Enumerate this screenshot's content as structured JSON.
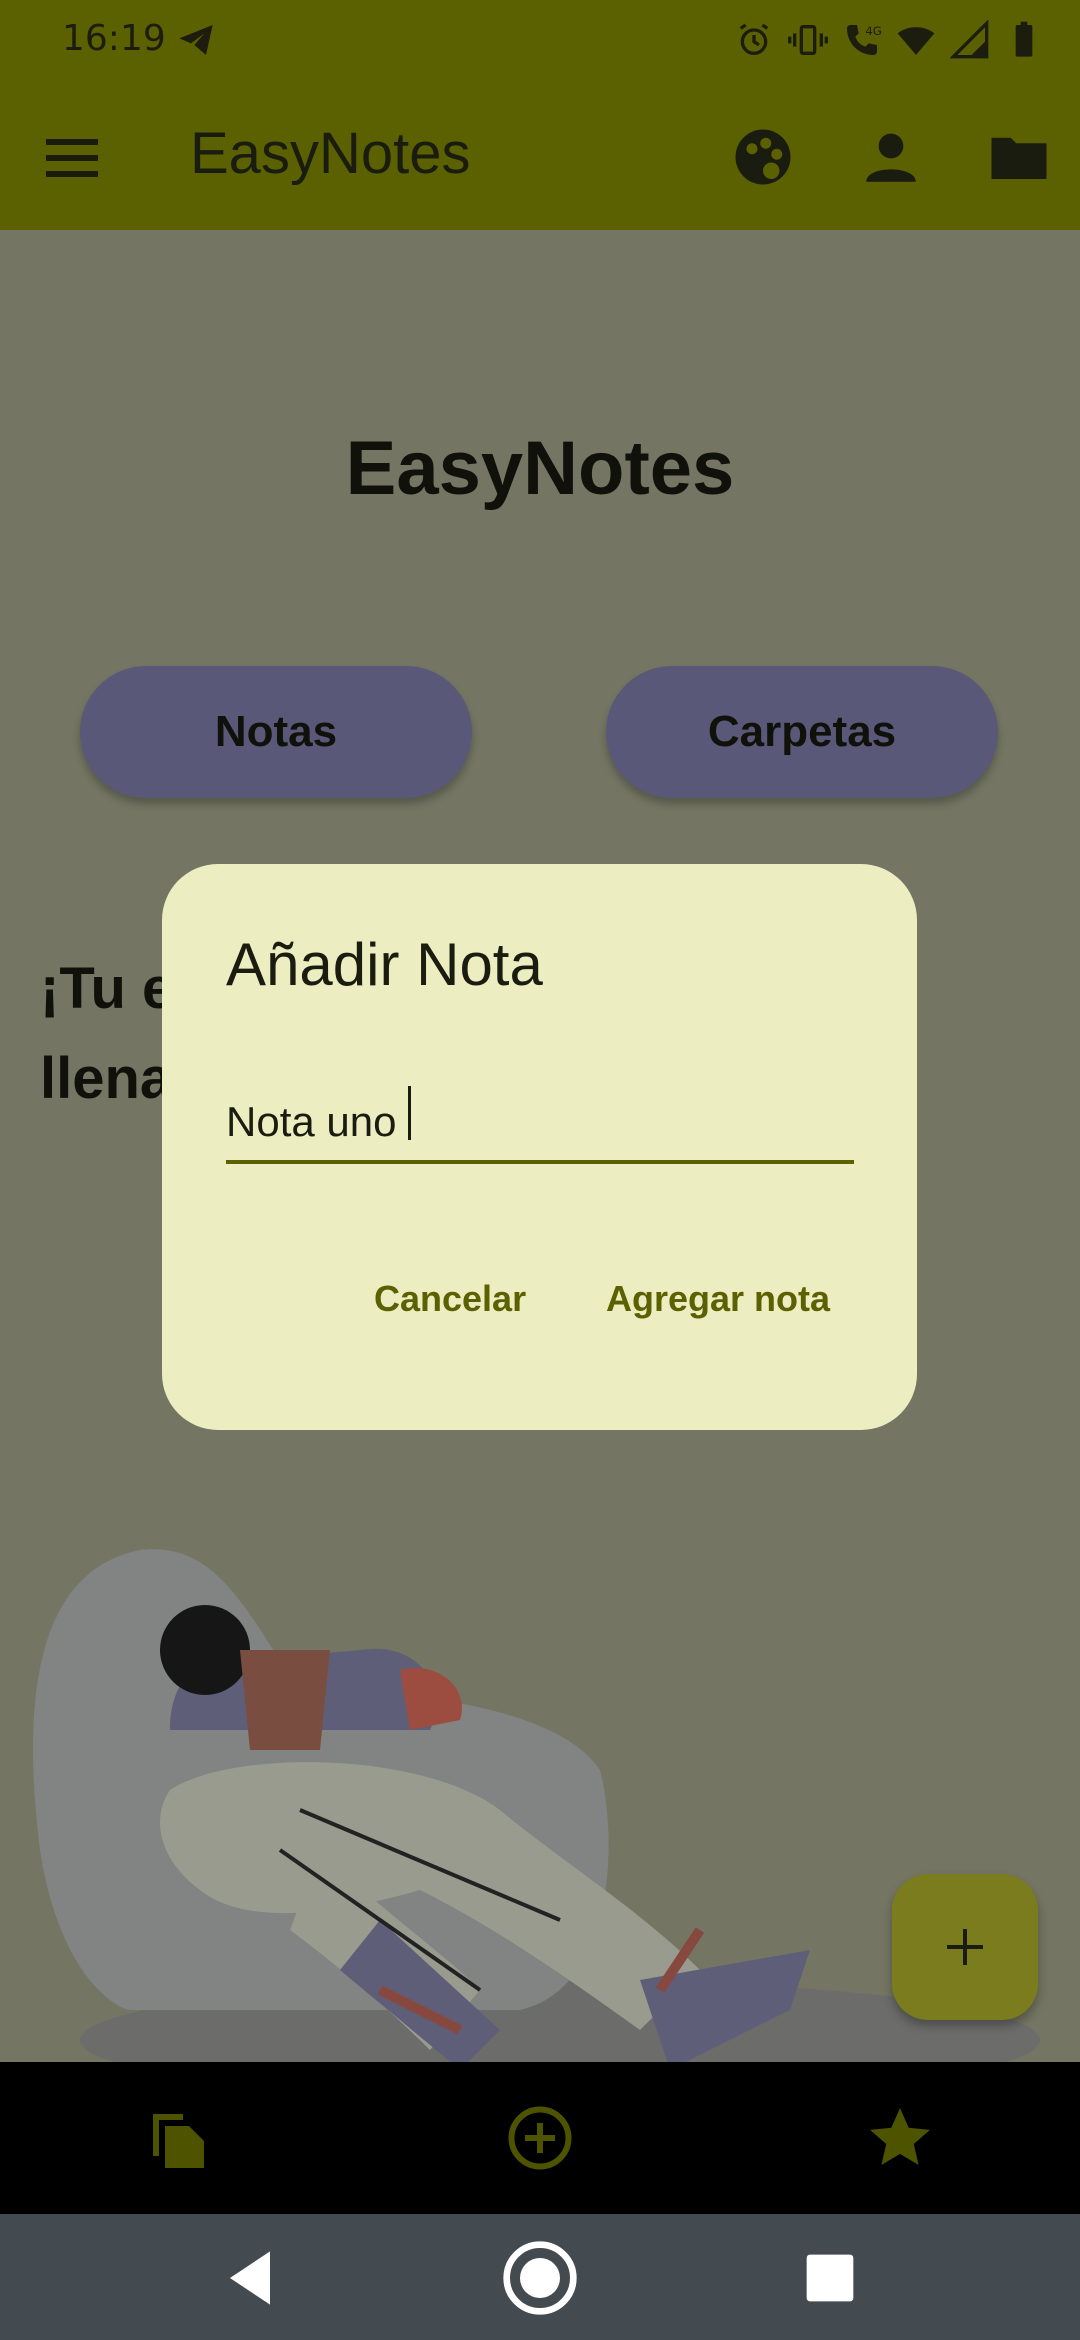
{
  "status_bar": {
    "time": "16:19",
    "icons": [
      "telegram-icon",
      "alarm-icon",
      "vibrate-icon",
      "volte-call-icon",
      "wifi-icon",
      "signal-icon",
      "battery-icon"
    ]
  },
  "app_bar": {
    "title": "EasyNotes",
    "icons": [
      "menu-icon",
      "palette-icon",
      "account-icon",
      "folder-icon"
    ]
  },
  "main": {
    "title": "EasyNotes",
    "buttons": {
      "notas": "Notas",
      "carpetas": "Carpetas"
    },
    "welcome_partial": "¡Tu e\nllena"
  },
  "dialog": {
    "title": "Añadir Nota",
    "input_value": "Nota uno",
    "cancel_label": "Cancelar",
    "add_label": "Agregar nota"
  },
  "fab": {
    "icon": "plus-icon"
  },
  "bottom_nav": {
    "icons": [
      "notes-copy-icon",
      "add-circle-icon",
      "star-icon"
    ]
  },
  "system_nav": {
    "icons": [
      "back-icon",
      "home-icon",
      "recents-icon"
    ]
  },
  "colors": {
    "appbar": "#5b6100",
    "dialog_bg": "#ecedc1",
    "accent_text": "#5b6100",
    "pill_bg": "#5a5878",
    "scrim_bg": "#747663"
  }
}
